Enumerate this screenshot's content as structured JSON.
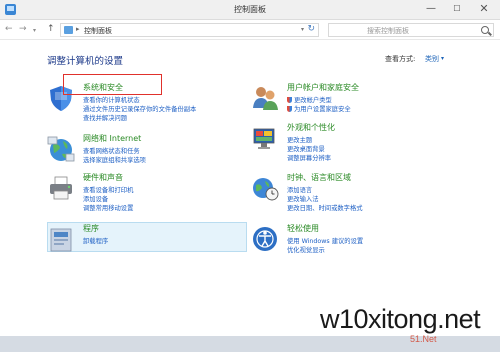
{
  "window": {
    "title": "控制面板",
    "minimize": "—",
    "maximize": "☐",
    "close": "✕"
  },
  "nav": {
    "back": "←",
    "forward": "→",
    "up": "↑",
    "address_sep": "▸",
    "address": "控制面板",
    "refresh": "↻",
    "search_placeholder": "搜索控制面板"
  },
  "page": {
    "title": "调整计算机的设置",
    "view_by_label": "查看方式:",
    "view_by_value": "类别",
    "view_by_arrow": "▾"
  },
  "categories": [
    {
      "title": "系统和安全",
      "icon": "system-security-icon",
      "links": [
        "查看你的计算机状态",
        "通过文件历史记录保存你的文件备份副本",
        "查找并解决问题"
      ]
    },
    {
      "title": "网络和 Internet",
      "icon": "network-icon",
      "links": [
        "查看网络状态和任务",
        "选择家庭组和共享选项"
      ]
    },
    {
      "title": "硬件和声音",
      "icon": "hardware-sound-icon",
      "links": [
        "查看设备和打印机",
        "添加设备",
        "调整常用移动设置"
      ]
    },
    {
      "title": "程序",
      "icon": "programs-icon",
      "links": [
        "卸载程序"
      ]
    },
    {
      "title": "用户帐户和家庭安全",
      "icon": "user-accounts-icon",
      "links": [
        "更改帐户类型",
        "为用户设置家庭安全"
      ]
    },
    {
      "title": "外观和个性化",
      "icon": "appearance-icon",
      "links": [
        "更改主题",
        "更改桌面背景",
        "调整屏幕分辨率"
      ]
    },
    {
      "title": "时钟、语言和区域",
      "icon": "clock-language-icon",
      "links": [
        "添加语言",
        "更改输入法",
        "更改日期、时间或数字格式"
      ]
    },
    {
      "title": "轻松使用",
      "icon": "ease-of-access-icon",
      "links": [
        "使用 Windows 建议的设置",
        "优化视觉显示"
      ]
    }
  ],
  "watermark": {
    "main": "w10xitong.net",
    "sub": "51.Net"
  }
}
